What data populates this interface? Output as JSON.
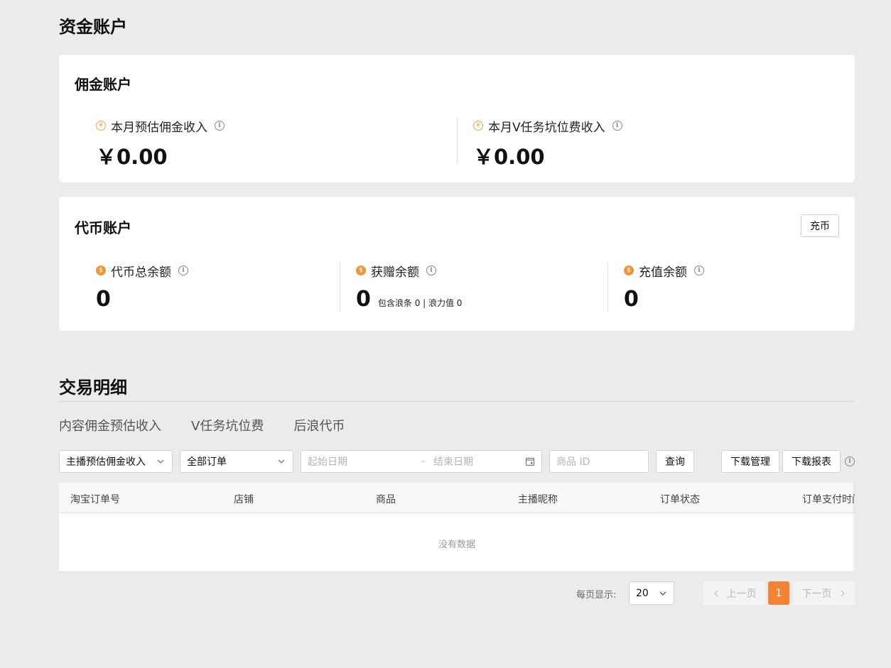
{
  "page": {
    "title": "资金账户"
  },
  "commission_account": {
    "title": "佣金账户",
    "stats": [
      {
        "label": "本月预估佣金收入",
        "value": "￥0.00",
        "icon": "yuan-coin-icon"
      },
      {
        "label": "本月V任务坑位费收入",
        "value": "￥0.00",
        "icon": "yuan-coin-icon"
      }
    ]
  },
  "token_account": {
    "title": "代币账户",
    "recharge_label": "充币",
    "stats": [
      {
        "label": "代币总余额",
        "value": "0",
        "sub": ""
      },
      {
        "label": "获赠余额",
        "value": "0",
        "sub": "包含浪条 0 | 浪力值 0"
      },
      {
        "label": "充值余额",
        "value": "0",
        "sub": ""
      }
    ]
  },
  "transactions": {
    "title": "交易明细",
    "tabs": [
      "内容佣金预估收入",
      "V任务坑位费",
      "后浪代币"
    ],
    "filters": {
      "type_select": "主播预估佣金收入",
      "order_select": "全部订单",
      "start_date_placeholder": "起始日期",
      "date_separator": "–",
      "end_date_placeholder": "结束日期",
      "product_id_placeholder": "商品 ID",
      "query_label": "查询",
      "download_manage_label": "下载管理",
      "download_report_label": "下载报表"
    },
    "columns": [
      "淘宝订单号",
      "店铺",
      "商品",
      "主播昵称",
      "订单状态",
      "订单支付时间"
    ],
    "empty_text": "没有数据",
    "pagination": {
      "per_page_label": "每页显示:",
      "per_page_value": "20",
      "prev_label": "上一页",
      "current_page": "1",
      "next_label": "下一页"
    }
  },
  "colors": {
    "accent": "#f28334",
    "coin": "#f0963a",
    "background": "#ebebeb"
  }
}
